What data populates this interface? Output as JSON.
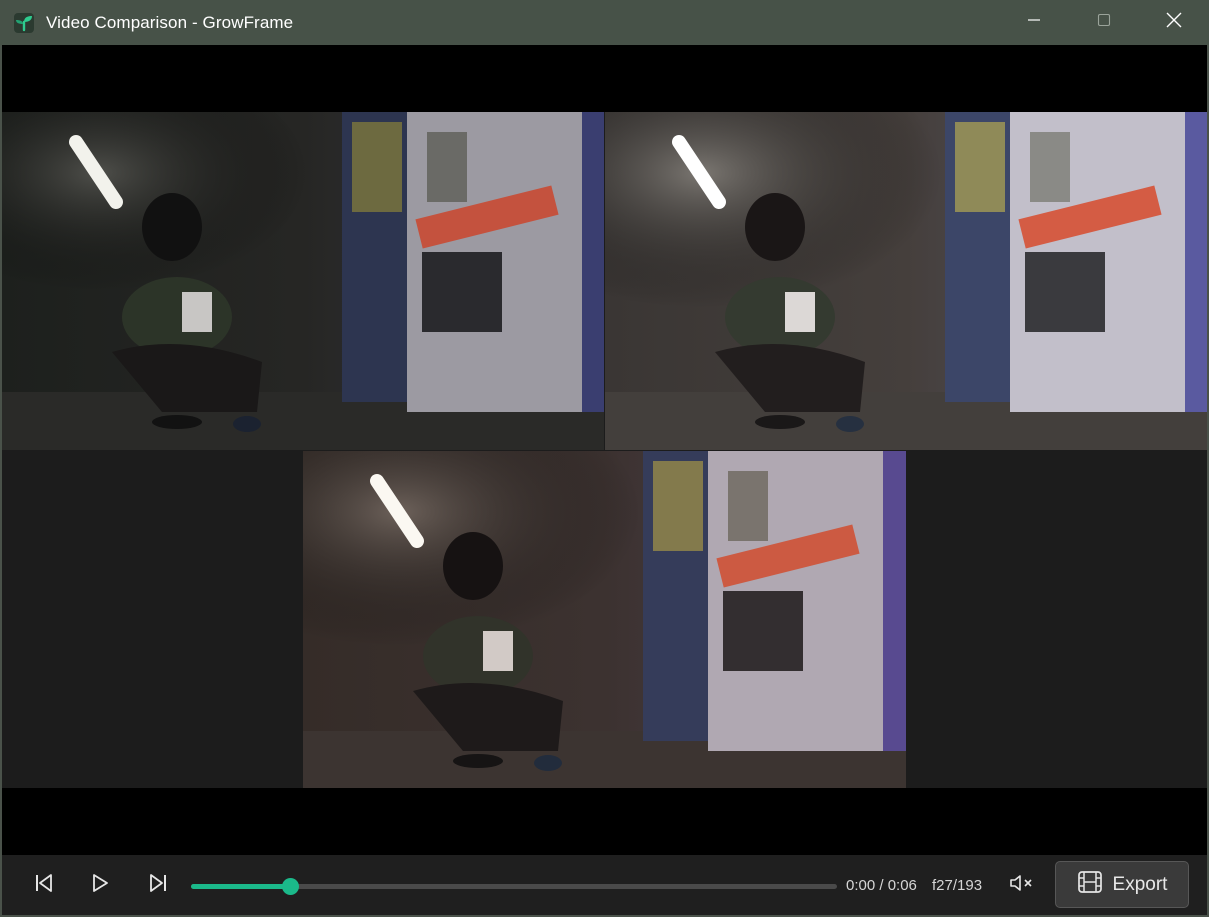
{
  "window": {
    "title": "Video Comparison - GrowFrame",
    "app_icon": "sprout-icon",
    "controls": [
      "minimize-icon",
      "maximize-icon",
      "close-icon"
    ]
  },
  "player": {
    "time": "0:00 / 0:06",
    "frame": "f27/193",
    "progress": 0.153,
    "muted": true,
    "export_label": "Export",
    "buttons": [
      "skip-back-icon",
      "play-icon",
      "skip-forward-icon",
      "mute-icon",
      "film-icon"
    ]
  },
  "colors": {
    "accent": "#1bb98a",
    "titlebar": "#475248",
    "panel": "#1f1f1f"
  },
  "frames": [
    {
      "name": "comparison-frame-1",
      "tone": "dark"
    },
    {
      "name": "comparison-frame-2",
      "tone": "bright"
    },
    {
      "name": "comparison-frame-3",
      "tone": "warm"
    }
  ]
}
